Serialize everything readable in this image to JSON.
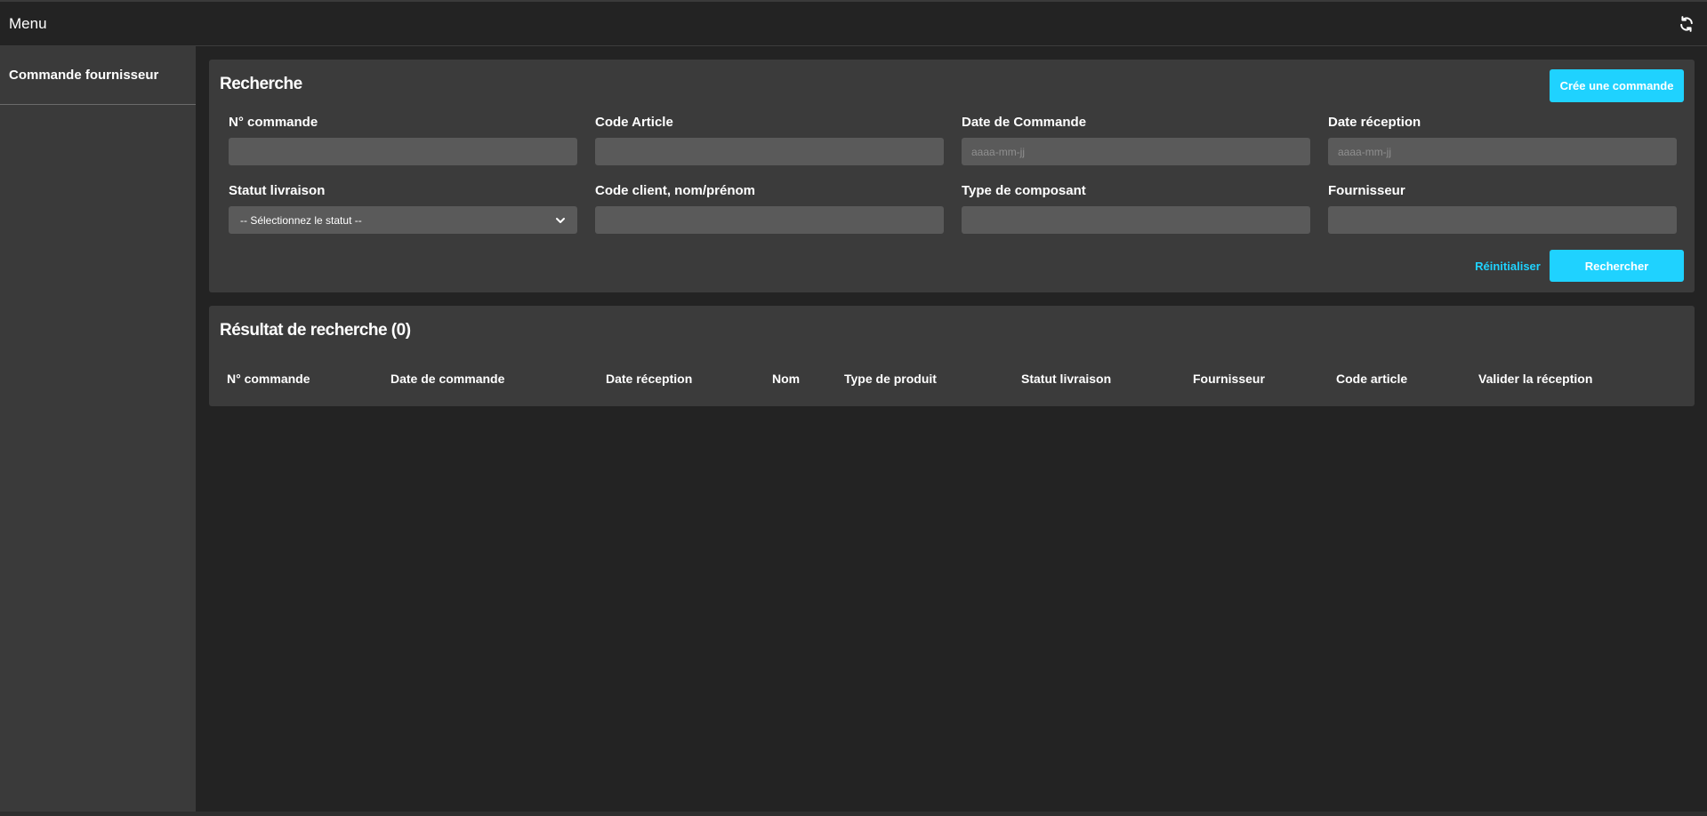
{
  "header": {
    "menu_label": "Menu",
    "refresh_icon": "refresh-icon"
  },
  "sidebar": {
    "items": [
      {
        "label": "Commande fournisseur"
      }
    ]
  },
  "search": {
    "title": "Recherche",
    "create_button": "Crée une commande",
    "fields": {
      "order_number": {
        "label": "N° commande",
        "value": "",
        "placeholder": ""
      },
      "article_code": {
        "label": "Code Article",
        "value": "",
        "placeholder": ""
      },
      "order_date": {
        "label": "Date de Commande",
        "value": "",
        "placeholder": "aaaa-mm-jj"
      },
      "reception_date": {
        "label": "Date réception",
        "value": "",
        "placeholder": "aaaa-mm-jj"
      },
      "delivery_status": {
        "label": "Statut livraison",
        "selected": "-- Sélectionnez le statut --"
      },
      "client": {
        "label": "Code client, nom/prénom",
        "value": "",
        "placeholder": ""
      },
      "component_type": {
        "label": "Type de composant",
        "value": "",
        "placeholder": ""
      },
      "supplier": {
        "label": "Fournisseur",
        "value": "",
        "placeholder": ""
      }
    },
    "reset_button": "Réinitialiser",
    "search_button": "Rechercher"
  },
  "results": {
    "title": "Résultat de recherche (0)",
    "columns": [
      "N° commande",
      "Date de commande",
      "Date réception",
      "Nom",
      "Type de produit",
      "Statut livraison",
      "Fournisseur",
      "Code article",
      "Valider la réception"
    ],
    "rows": []
  },
  "colors": {
    "accent": "#1fd2ff",
    "panel": "#3b3b3b",
    "background": "#232323",
    "sidebar": "#3a3a3a",
    "input": "#5a5a5a"
  }
}
